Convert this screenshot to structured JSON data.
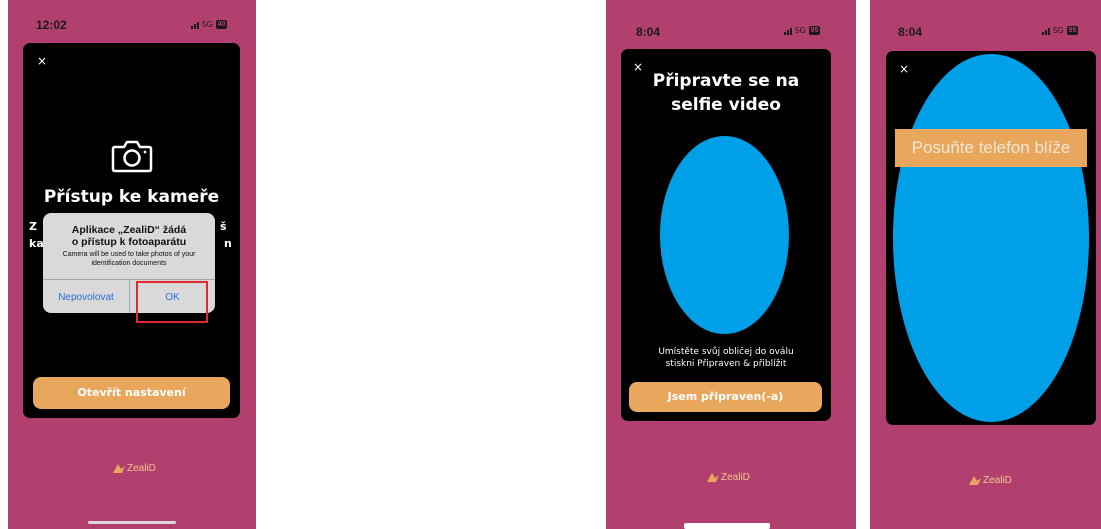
{
  "screen1": {
    "status": {
      "time": "12:02",
      "network": "5G",
      "battery": "40"
    },
    "close_glyph": "×",
    "title": "Přístup ke kameře",
    "partial_left_1": "Z",
    "partial_left_2": "ka",
    "partial_right_1": "š",
    "partial_right_2": "n",
    "dialog": {
      "title_line1": "Aplikace „ZealiD“ žádá",
      "title_line2": "o přístup k fotoaparátu",
      "message": "Camera will be used to take photos of your identification documents",
      "deny_label": "Nepovolovat",
      "ok_label": "OK"
    },
    "settings_button": "Otevřít nastavení",
    "logo_text": "ZealiD"
  },
  "screen2": {
    "status": {
      "time": "8:04",
      "network": "5G",
      "battery": "95"
    },
    "close_glyph": "×",
    "title_line1": "Připravte se na",
    "title_line2": "selfie video",
    "instruction_line1": "Umístěte svůj obličej do oválu",
    "instruction_line2": "stiskni Připraven & přiblížit",
    "ready_button": "Jsem připraven(-a)",
    "logo_text": "ZealiD"
  },
  "screen3": {
    "status": {
      "time": "8:04",
      "network": "5G",
      "battery": "95"
    },
    "close_glyph": "×",
    "banner_text": "Posuňte telefon blíže",
    "logo_text": "ZealiD"
  },
  "colors": {
    "background": "#b2406f",
    "card": "#000000",
    "accent": "#e9a65d",
    "oval": "#00a0e8",
    "highlight": "#e0282f",
    "ios_link": "#2a6fdc"
  },
  "icons": [
    "camera-icon",
    "close-icon",
    "zealid-logo-icon",
    "signal-bars-icon",
    "battery-icon"
  ]
}
